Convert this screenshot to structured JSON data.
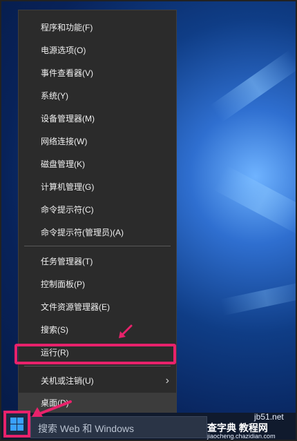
{
  "context_menu": {
    "group1": [
      {
        "label": "程序和功能(F)"
      },
      {
        "label": "电源选项(O)"
      },
      {
        "label": "事件查看器(V)"
      },
      {
        "label": "系统(Y)"
      },
      {
        "label": "设备管理器(M)"
      },
      {
        "label": "网络连接(W)"
      },
      {
        "label": "磁盘管理(K)"
      },
      {
        "label": "计算机管理(G)"
      },
      {
        "label": "命令提示符(C)"
      },
      {
        "label": "命令提示符(管理员)(A)"
      }
    ],
    "group2": [
      {
        "label": "任务管理器(T)"
      },
      {
        "label": "控制面板(P)"
      },
      {
        "label": "文件资源管理器(E)"
      },
      {
        "label": "搜索(S)"
      },
      {
        "label": "运行(R)"
      }
    ],
    "group3": [
      {
        "label": "关机或注销(U)",
        "chevron": "›"
      },
      {
        "label": "桌面(D)"
      }
    ]
  },
  "taskbar": {
    "search_placeholder": "搜索 Web 和 Windows"
  },
  "watermark": {
    "site": "jb51.net",
    "brand": "查字典 教程网",
    "url": "jiaocheng.chazidian.com"
  },
  "colors": {
    "menu_bg": "#2b2b2b",
    "highlight": "#e8226b",
    "windows_blue": "#3aa0ff"
  }
}
